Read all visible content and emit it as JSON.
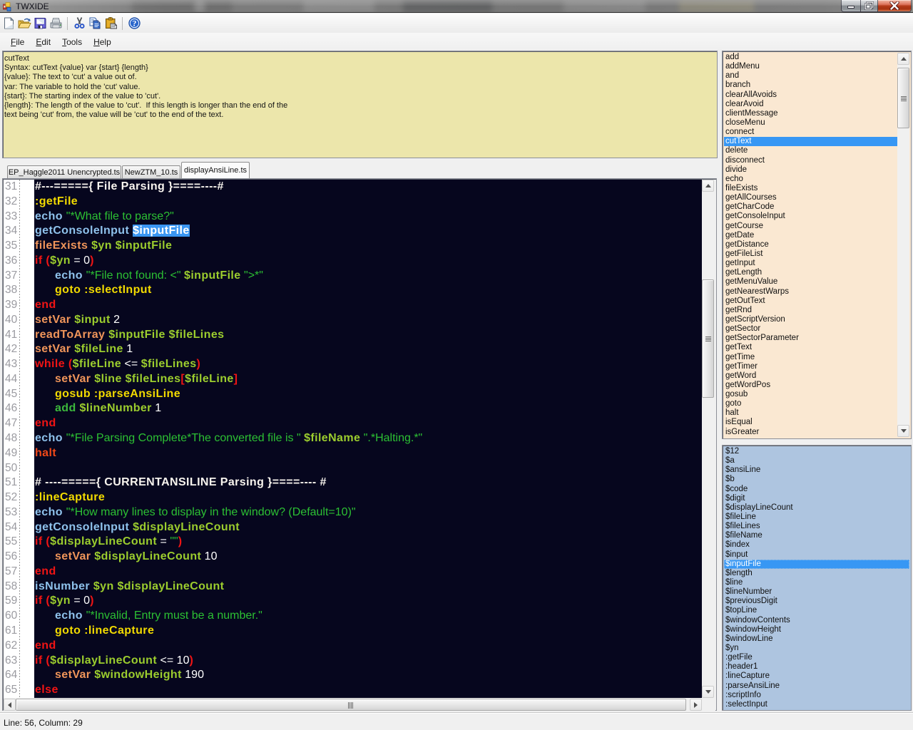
{
  "window": {
    "title": "TWXIDE"
  },
  "titlebar": {
    "buttons": [
      "minimize",
      "maximize",
      "close"
    ]
  },
  "toolbar": {
    "buttons": [
      "new",
      "open",
      "save",
      "print",
      "cut",
      "copy",
      "paste",
      "help"
    ]
  },
  "menubar": {
    "items": [
      {
        "label": "File",
        "hotkey": "F"
      },
      {
        "label": "Edit",
        "hotkey": "E"
      },
      {
        "label": "Tools",
        "hotkey": "T"
      },
      {
        "label": "Help",
        "hotkey": "H"
      }
    ]
  },
  "help_panel": {
    "lines": [
      "cutText",
      "Syntax: cutText {value} var {start} {length}",
      "{value}: The text to 'cut' a value out of.",
      "var: The variable to hold the 'cut' value.",
      "{start}: The starting index of the value to 'cut'.",
      "{length}: The length of the value to 'cut'.  If this length is longer than the end of the",
      "text being 'cut' from, the value will be 'cut' to the end of the text."
    ]
  },
  "commands_list": {
    "selected": "cutText",
    "items": [
      "add",
      "addMenu",
      "and",
      "branch",
      "clearAllAvoids",
      "clearAvoid",
      "clientMessage",
      "closeMenu",
      "connect",
      "cutText",
      "delete",
      "disconnect",
      "divide",
      "echo",
      "fileExists",
      "getAllCourses",
      "getCharCode",
      "getConsoleInput",
      "getCourse",
      "getDate",
      "getDistance",
      "getFileList",
      "getInput",
      "getLength",
      "getMenuValue",
      "getNearestWarps",
      "getOutText",
      "getRnd",
      "getScriptVersion",
      "getSector",
      "getSectorParameter",
      "getText",
      "getTime",
      "getTimer",
      "getWord",
      "getWordPos",
      "gosub",
      "goto",
      "halt",
      "isEqual",
      "isGreater"
    ]
  },
  "variables_list": {
    "selected": "$inputFile",
    "items": [
      "$12",
      "$a",
      "$ansiLine",
      "$b",
      "$code",
      "$digit",
      "$displayLineCount",
      "$fileLine",
      "$fileLines",
      "$fileName",
      "$index",
      "$input",
      "$inputFile",
      "$length",
      "$line",
      "$lineNumber",
      "$previousDigit",
      "$topLine",
      "$windowContents",
      "$windowHeight",
      "$windowLine",
      "$yn",
      ":getFile",
      ":header1",
      ":lineCapture",
      ":parseAnsiLine",
      ":scriptInfo",
      ":selectInput"
    ]
  },
  "tabs": [
    {
      "label": "EP_Haggle2011 Unencrypted.ts",
      "active": false
    },
    {
      "label": "NewZTM_10.ts",
      "active": false
    },
    {
      "label": "displayAnsiLine.ts",
      "active": true
    }
  ],
  "editor": {
    "colors": {
      "background": "#06061e",
      "comment": "#f8f4ee",
      "label": "#f0d800",
      "builtin_blue": "#8fc1e8",
      "string": "#2eba3e",
      "variable": "#9ccd2e",
      "command_orange": "#f09b50",
      "keyword_red": "#f01818",
      "operator": "#ffffff",
      "command_green": "#3cb83c",
      "halt_orange": "#f04818",
      "selection": "#2f8be4"
    },
    "lines": [
      {
        "num": 31,
        "indent": 0,
        "tokens": [
          [
            "cm",
            "#---====={ File Parsing }====----#"
          ]
        ]
      },
      {
        "num": 32,
        "indent": 0,
        "tokens": [
          [
            "lbl",
            ":getFile"
          ]
        ]
      },
      {
        "num": 33,
        "indent": 0,
        "tokens": [
          [
            "kwb",
            "echo "
          ],
          [
            "str",
            "\"*What file to parse?\""
          ]
        ]
      },
      {
        "num": 34,
        "indent": 0,
        "tokens": [
          [
            "kwb",
            "getConsoleInput "
          ],
          [
            "sel",
            "$inputFile"
          ]
        ]
      },
      {
        "num": 35,
        "indent": 0,
        "tokens": [
          [
            "cmd",
            "fileExists "
          ],
          [
            "var",
            "$yn $inputFile"
          ]
        ]
      },
      {
        "num": 36,
        "indent": 0,
        "tokens": [
          [
            "kw",
            "if ("
          ],
          [
            "var",
            "$yn"
          ],
          [
            "op",
            " = 0"
          ],
          [
            "kw",
            ")"
          ]
        ]
      },
      {
        "num": 37,
        "indent": 1,
        "tokens": [
          [
            "kwb",
            "echo "
          ],
          [
            "str",
            "\"*File not found: <\" "
          ],
          [
            "var",
            "$inputFile"
          ],
          [
            "str",
            " \">*\""
          ]
        ]
      },
      {
        "num": 38,
        "indent": 1,
        "tokens": [
          [
            "lbl",
            "goto :selectInput"
          ]
        ]
      },
      {
        "num": 39,
        "indent": 0,
        "tokens": [
          [
            "kw",
            "end"
          ]
        ]
      },
      {
        "num": 40,
        "indent": 0,
        "tokens": [
          [
            "cmd",
            "setVar "
          ],
          [
            "var",
            "$input"
          ],
          [
            "op",
            " 2"
          ]
        ]
      },
      {
        "num": 41,
        "indent": 0,
        "tokens": [
          [
            "cmd",
            "readToArray "
          ],
          [
            "var",
            "$inputFile $fileLines"
          ]
        ]
      },
      {
        "num": 42,
        "indent": 0,
        "tokens": [
          [
            "cmd",
            "setVar "
          ],
          [
            "var",
            "$fileLine"
          ],
          [
            "op",
            " 1"
          ]
        ]
      },
      {
        "num": 43,
        "indent": 0,
        "tokens": [
          [
            "kw",
            "while ("
          ],
          [
            "var",
            "$fileLine"
          ],
          [
            "op",
            " <= "
          ],
          [
            "var",
            "$fileLines"
          ],
          [
            "kw",
            ")"
          ]
        ]
      },
      {
        "num": 44,
        "indent": 1,
        "tokens": [
          [
            "cmd",
            "setVar "
          ],
          [
            "var",
            "$line $fileLines"
          ],
          [
            "kw",
            "["
          ],
          [
            "var",
            "$fileLine"
          ],
          [
            "kw",
            "]"
          ]
        ]
      },
      {
        "num": 45,
        "indent": 1,
        "tokens": [
          [
            "lbl",
            "gosub :parseAnsiLine"
          ]
        ]
      },
      {
        "num": 46,
        "indent": 1,
        "tokens": [
          [
            "grn",
            "add "
          ],
          [
            "var",
            "$lineNumber"
          ],
          [
            "op",
            " 1"
          ]
        ]
      },
      {
        "num": 47,
        "indent": 0,
        "tokens": [
          [
            "kw",
            "end"
          ]
        ]
      },
      {
        "num": 48,
        "indent": 0,
        "tokens": [
          [
            "kwb",
            "echo "
          ],
          [
            "str",
            "\"*File Parsing Complete*The converted file is \" "
          ],
          [
            "var",
            "$fileName"
          ],
          [
            "str",
            " \".*Halting.*\""
          ]
        ]
      },
      {
        "num": 49,
        "indent": 0,
        "tokens": [
          [
            "halt",
            "halt"
          ]
        ]
      },
      {
        "num": 50,
        "indent": 0,
        "tokens": []
      },
      {
        "num": 51,
        "indent": 0,
        "tokens": [
          [
            "cm",
            "# ----====={ CURRENTANSILINE Parsing }====---- #"
          ]
        ]
      },
      {
        "num": 52,
        "indent": 0,
        "tokens": [
          [
            "lbl",
            ":lineCapture"
          ]
        ]
      },
      {
        "num": 53,
        "indent": 0,
        "tokens": [
          [
            "kwb",
            "echo "
          ],
          [
            "str",
            "\"*How many lines to display in the window? (Default=10)\""
          ]
        ]
      },
      {
        "num": 54,
        "indent": 0,
        "tokens": [
          [
            "kwb",
            "getConsoleInput "
          ],
          [
            "var",
            "$displayLineCount"
          ]
        ]
      },
      {
        "num": 55,
        "indent": 0,
        "tokens": [
          [
            "kw",
            "if ("
          ],
          [
            "var",
            "$displayLineCount"
          ],
          [
            "op",
            " = "
          ],
          [
            "str",
            "\"\""
          ],
          [
            "kw",
            ")"
          ]
        ]
      },
      {
        "num": 56,
        "indent": 1,
        "tokens": [
          [
            "cmd",
            "setVar "
          ],
          [
            "var",
            "$displayLineCount"
          ],
          [
            "op",
            " 10"
          ]
        ]
      },
      {
        "num": 57,
        "indent": 0,
        "tokens": [
          [
            "kw",
            "end"
          ]
        ]
      },
      {
        "num": 58,
        "indent": 0,
        "tokens": [
          [
            "kwb",
            "isNumber "
          ],
          [
            "var",
            "$yn $displayLineCount"
          ]
        ]
      },
      {
        "num": 59,
        "indent": 0,
        "tokens": [
          [
            "kw",
            "if ("
          ],
          [
            "var",
            "$yn"
          ],
          [
            "op",
            " = 0"
          ],
          [
            "kw",
            ")"
          ]
        ]
      },
      {
        "num": 60,
        "indent": 1,
        "tokens": [
          [
            "kwb",
            "echo "
          ],
          [
            "str",
            "\"*Invalid, Entry must be a number.\""
          ]
        ]
      },
      {
        "num": 61,
        "indent": 1,
        "tokens": [
          [
            "lbl",
            "goto :lineCapture"
          ]
        ]
      },
      {
        "num": 62,
        "indent": 0,
        "tokens": [
          [
            "kw",
            "end"
          ]
        ]
      },
      {
        "num": 63,
        "indent": 0,
        "tokens": [
          [
            "kw",
            "if ("
          ],
          [
            "var",
            "$displayLineCount"
          ],
          [
            "op",
            " <= 10"
          ],
          [
            "kw",
            ")"
          ]
        ]
      },
      {
        "num": 64,
        "indent": 1,
        "tokens": [
          [
            "cmd",
            "setVar "
          ],
          [
            "var",
            "$windowHeight"
          ],
          [
            "op",
            " 190"
          ]
        ]
      },
      {
        "num": 65,
        "indent": 0,
        "tokens": [
          [
            "kw",
            "else"
          ]
        ]
      }
    ]
  },
  "statusbar": {
    "text": "Line: 56, Column: 29"
  }
}
